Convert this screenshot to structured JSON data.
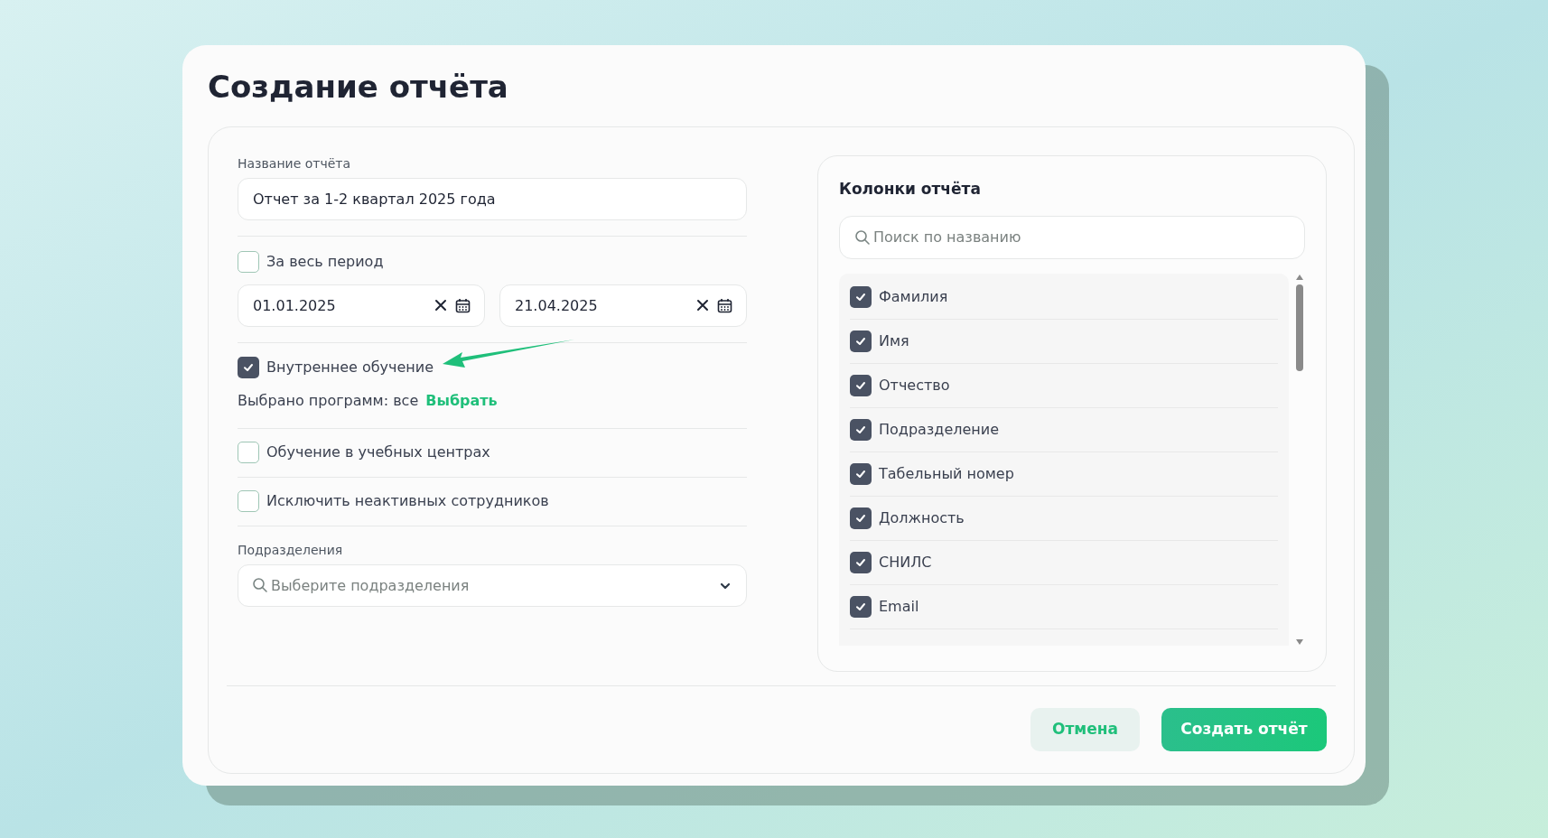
{
  "dialog": {
    "title": "Создание отчёта"
  },
  "report_name": {
    "label": "Название отчёта",
    "value": "Отчет за 1-2 квартал 2025 года"
  },
  "whole_period": {
    "label": "За весь период",
    "checked": false
  },
  "date_from": {
    "value": "01.01.2025"
  },
  "date_to": {
    "value": "21.04.2025"
  },
  "internal_training": {
    "label": "Внутреннее обучение",
    "checked": true
  },
  "programs": {
    "text": "Выбрано программ: все",
    "link": "Выбрать"
  },
  "training_centers": {
    "label": "Обучение в учебных центрах",
    "checked": false
  },
  "exclude_inactive": {
    "label": "Исключить неактивных сотрудников",
    "checked": false
  },
  "departments": {
    "label": "Подразделения",
    "placeholder": "Выберите подразделения"
  },
  "columns_panel": {
    "title": "Колонки отчёта",
    "search_placeholder": "Поиск по названию",
    "items": [
      {
        "label": "Фамилия",
        "checked": true
      },
      {
        "label": "Имя",
        "checked": true
      },
      {
        "label": "Отчество",
        "checked": true
      },
      {
        "label": "Подразделение",
        "checked": true
      },
      {
        "label": "Табельный номер",
        "checked": true
      },
      {
        "label": "Должность",
        "checked": true
      },
      {
        "label": "СНИЛС",
        "checked": true
      },
      {
        "label": "Email",
        "checked": true
      }
    ]
  },
  "buttons": {
    "cancel": "Отмена",
    "create": "Создать отчёт"
  }
}
